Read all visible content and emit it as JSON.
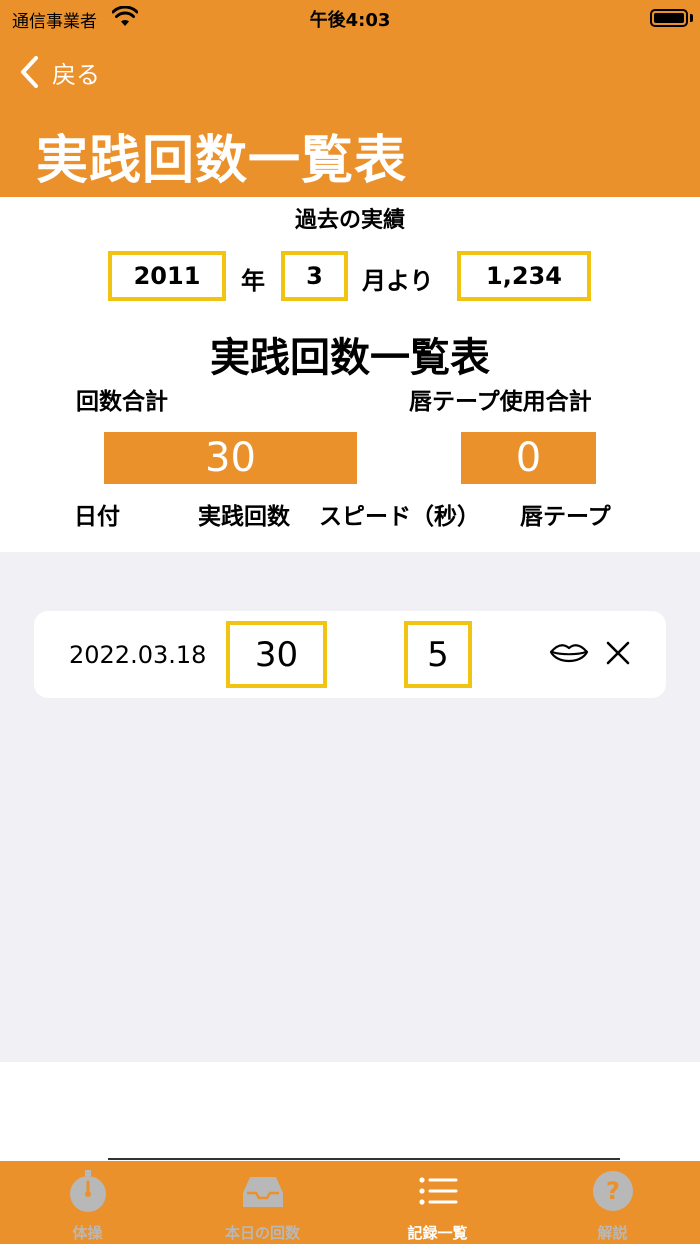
{
  "status_bar": {
    "carrier": "通信事業者",
    "time": "午後4:03"
  },
  "nav": {
    "back_label": "戻る",
    "title": "実践回数一覧表"
  },
  "summary": {
    "past_label": "過去の実績",
    "year": "2011",
    "year_unit": "年",
    "month": "3",
    "month_unit": "月より",
    "past_count": "1,234",
    "table_title": "実践回数一覧表",
    "total_count_label": "回数合計",
    "total_tape_label": "唇テープ使用合計",
    "total_count": "30",
    "total_tape": "0"
  },
  "columns": {
    "date": "日付",
    "count": "実践回数",
    "speed": "スピード（秒）",
    "tape": "唇テープ"
  },
  "records": [
    {
      "date": "2022.03.18",
      "count": "30",
      "speed": "5"
    }
  ],
  "tabs": [
    {
      "label": "体操",
      "icon": "stopwatch-icon",
      "active": false
    },
    {
      "label": "本日の回数",
      "icon": "inbox-tray-icon",
      "active": false
    },
    {
      "label": "記録一覧",
      "icon": "list-icon",
      "active": true
    },
    {
      "label": "解説",
      "icon": "question-circle-icon",
      "active": false
    }
  ],
  "colors": {
    "accent": "#EB912B",
    "highlight_border": "#F2C412",
    "list_background": "#F1F1F5"
  }
}
